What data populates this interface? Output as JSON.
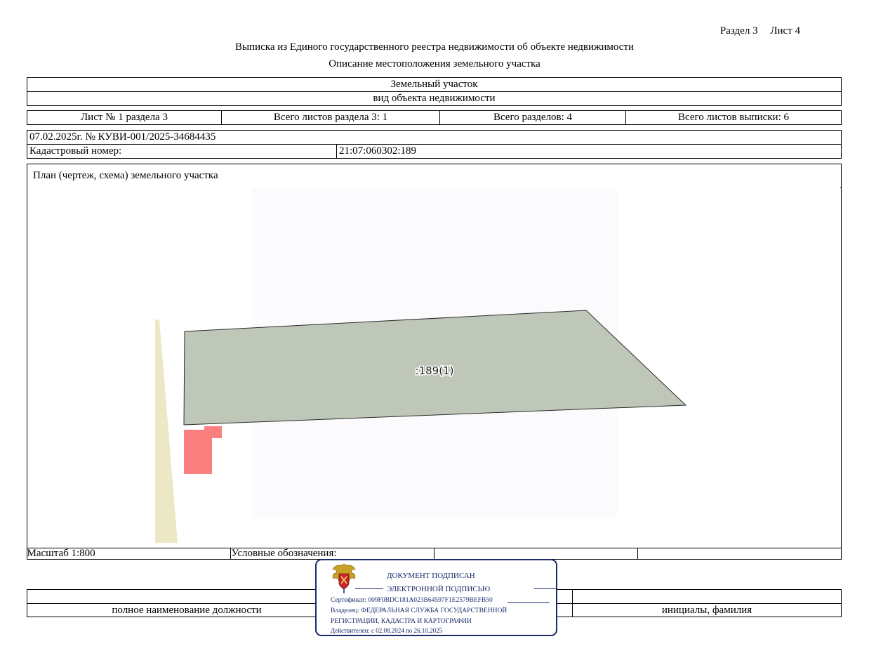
{
  "header": {
    "section": "Раздел 3",
    "sheet": "Лист 4",
    "title": "Выписка из Единого государственного реестра недвижимости об объекте недвижимости",
    "subtitle": "Описание местоположения земельного участка"
  },
  "object": {
    "type": "Земельный участок",
    "type_caption": "вид объекта недвижимости"
  },
  "sheet_info": {
    "sheet_no": "Лист № 1 раздела 3",
    "total_sheets_section": "Всего листов раздела 3: 1",
    "total_sections": "Всего разделов: 4",
    "total_sheets_extract": "Всего листов выписки: 6"
  },
  "record": {
    "date_number": "07.02.2025г. № КУВИ-001/2025-34684435",
    "cadastral_label": "Кадастровый номер:",
    "cadastral_value": "21:07:060302:189"
  },
  "plan": {
    "title": "План (чертеж, схема) земельного участка",
    "parcel_label": ":189(1)",
    "scale": "Масштаб 1:800",
    "legend_label": "Условные обозначения:",
    "colors": {
      "parcel_fill": "#bfc8b8",
      "building_fill": "#fb7f7f",
      "road_fill": "#ece8c6",
      "map_bg": "#fbfafd"
    }
  },
  "signature_rows": {
    "position_caption": "полное наименование должности",
    "name_caption": "инициалы, фамилия"
  },
  "stamp": {
    "line1": "ДОКУМЕНТ ПОДПИСАН",
    "line2": "ЭЛЕКТРОННОЙ ПОДПИСЬЮ",
    "certificate": "Сертификат: 009F0BDC181A023B64597F1E2579BEFB50",
    "owner_line1": "Владелец: ФЕДЕРАЛЬНАЯ СЛУЖБА ГОСУДАРСТВЕННОЙ",
    "owner_line2": "РЕГИСТРАЦИИ, КАДАСТРА И КАРТОГРАФИИ",
    "valid": "Действителен: с 02.08.2024 по 26.10.2025",
    "emblem_icon": "russian-coat-of-arms-icon"
  }
}
